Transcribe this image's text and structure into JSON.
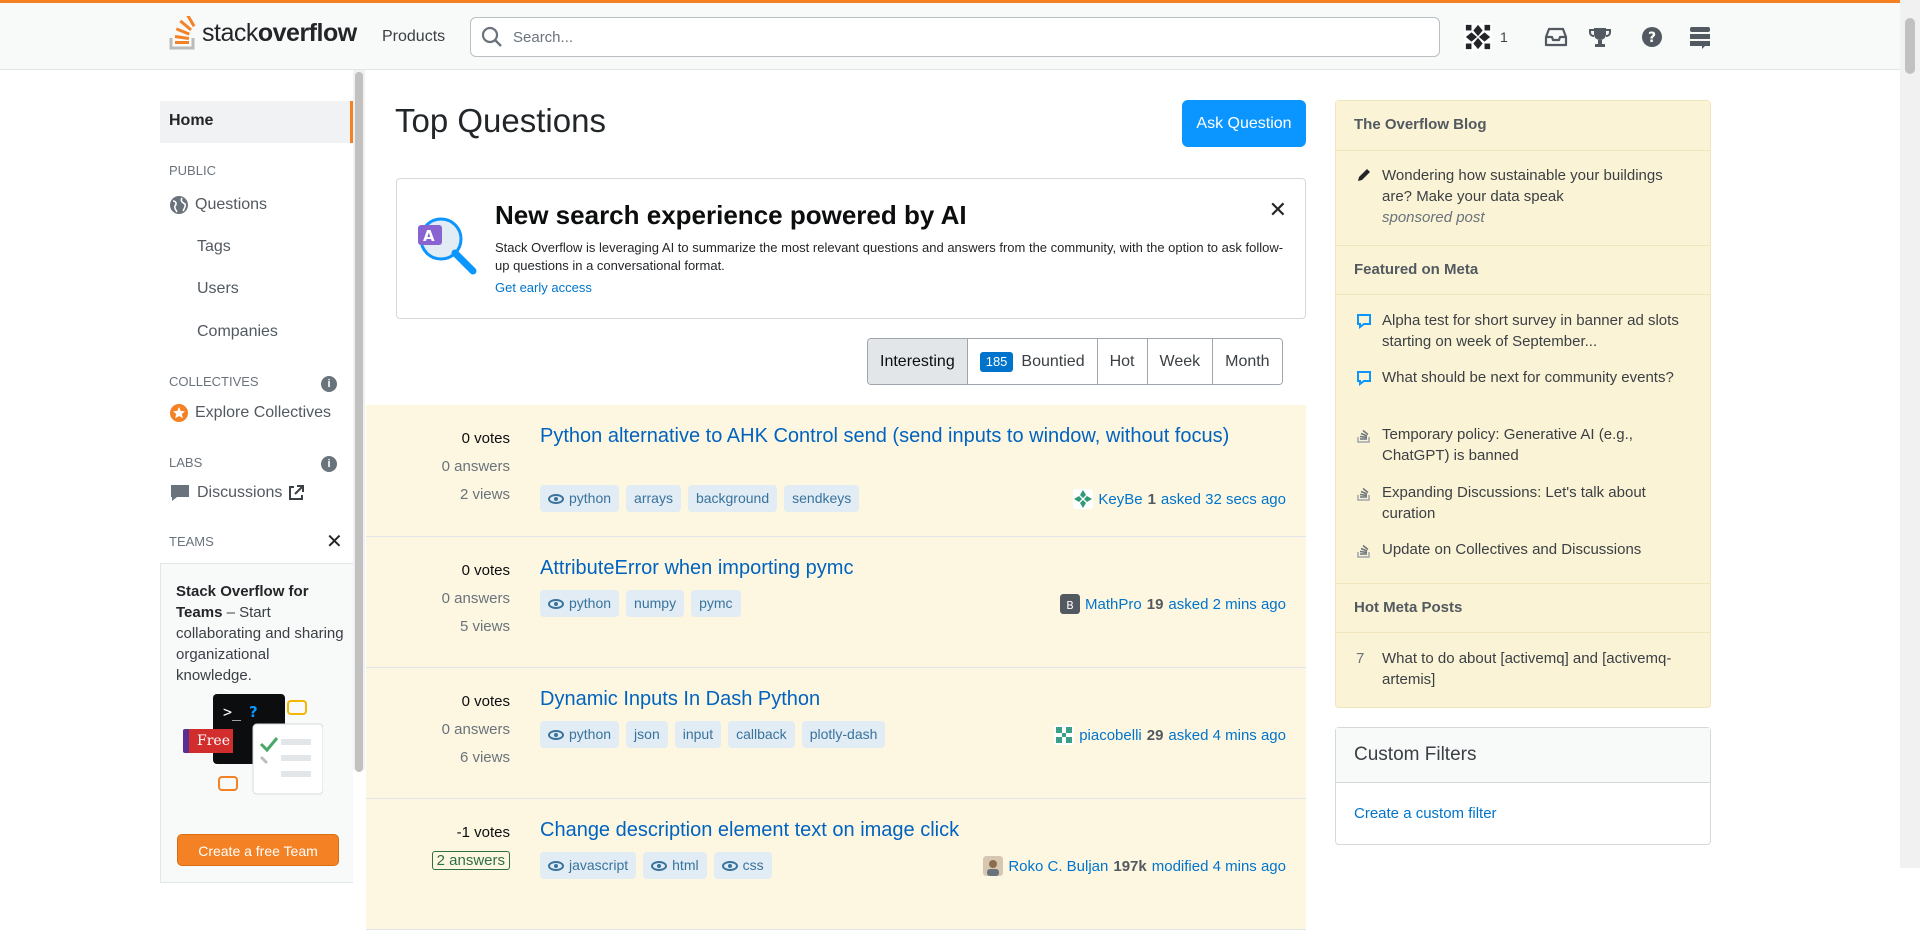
{
  "header": {
    "logo_light": "stack",
    "logo_bold": "overflow",
    "products": "Products",
    "search_placeholder": "Search...",
    "reputation": "1"
  },
  "sidebar": {
    "home": "Home",
    "public_label": "PUBLIC",
    "questions": "Questions",
    "tags": "Tags",
    "users": "Users",
    "companies": "Companies",
    "collectives_label": "COLLECTIVES",
    "explore_collectives": "Explore Collectives",
    "labs_label": "LABS",
    "discussions": "Discussions",
    "teams_label": "TEAMS",
    "teams_title": "Stack Overflow for Teams",
    "teams_text": " – Start collaborating and sharing organizational knowledge.",
    "free_label": "Free",
    "create_team": "Create a free Team"
  },
  "main": {
    "title": "Top Questions",
    "ask_button": "Ask Question",
    "ai_banner": {
      "title": "New search experience powered by AI",
      "description": "Stack Overflow is leveraging AI to summarize the most relevant questions and answers from the community, with the option to ask follow-up questions in a conversational format.",
      "link": "Get early access"
    },
    "filters": {
      "interesting": "Interesting",
      "bountied_count": "185",
      "bountied": "Bountied",
      "hot": "Hot",
      "week": "Week",
      "month": "Month"
    },
    "questions": [
      {
        "votes": "0 votes",
        "answers": "0 answers",
        "views": "2 views",
        "title": "Python alternative to AHK Control send (send inputs to window, without focus)",
        "tags": [
          "python",
          "arrays",
          "background",
          "sendkeys"
        ],
        "user": "KeyBe",
        "rep": "1",
        "when": "asked 32 secs ago"
      },
      {
        "votes": "0 votes",
        "answers": "0 answers",
        "views": "5 views",
        "title": "AttributeError when importing pymc",
        "tags": [
          "python",
          "numpy",
          "pymc"
        ],
        "user": "MathPro",
        "rep": "19",
        "when": "asked 2 mins ago"
      },
      {
        "votes": "0 votes",
        "answers": "0 answers",
        "views": "6 views",
        "title": "Dynamic Inputs In Dash Python",
        "tags": [
          "python",
          "json",
          "input",
          "callback",
          "plotly-dash"
        ],
        "user": "piacobelli",
        "rep": "29",
        "when": "asked 4 mins ago"
      },
      {
        "votes": "-1 votes",
        "answers": "2 answers",
        "views": "",
        "title": "Change description element text on image click",
        "tags": [
          "javascript",
          "html",
          "css"
        ],
        "user": "Roko C. Buljan",
        "rep": "197k",
        "when": "modified 4 mins ago"
      }
    ]
  },
  "right": {
    "blog_title": "The Overflow Blog",
    "blog_post": "Wondering how sustainable your buildings are? Make your data speak",
    "blog_sponsored": "sponsored post",
    "meta_title": "Featured on Meta",
    "meta_items": [
      "Alpha test for short survey in banner ad slots starting on week of September...",
      "What should be next for community events?",
      "Temporary policy: Generative AI (e.g., ChatGPT) is banned",
      "Expanding Discussions: Let's talk about curation",
      "Update on Collectives and Discussions"
    ],
    "hot_title": "Hot Meta Posts",
    "hot_num": "7",
    "hot_item": "What to do about [activemq] and [activemq-artemis]",
    "custom_title": "Custom Filters",
    "custom_link": "Create a custom filter"
  },
  "colors": {
    "accent": "#f48225",
    "link": "#0074cc",
    "button": "#0a95ff",
    "highlight": "#fdf7e2"
  }
}
